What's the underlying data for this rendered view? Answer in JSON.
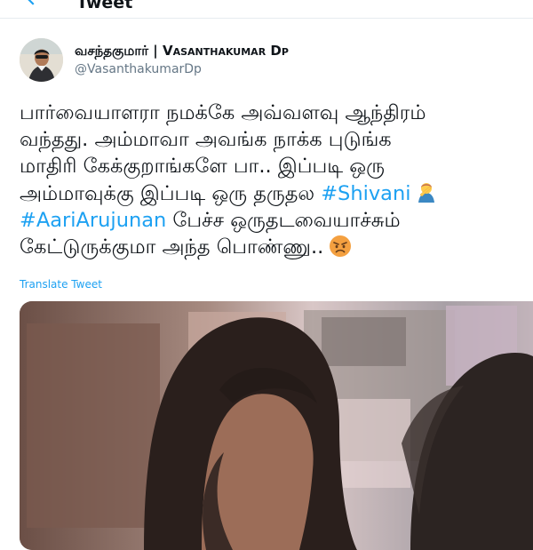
{
  "header": {
    "title": "Tweet"
  },
  "author": {
    "name_tamil": "வசந்தகுமார்",
    "separator": " | ",
    "name_latin": "Vasanthakumar Dp",
    "handle": "@VasanthakumarDp"
  },
  "tweet": {
    "line1": "பார்வையாளரா நமக்கே அவ்வளவு ஆந்திரம்",
    "line2": "வந்தது. அம்மாவா அவங்க நாக்க புடுங்க",
    "line3": "மாதிரி கேக்குறாங்களே பா.. இப்படி ஒரு",
    "line4_text": "அம்மாவுக்கு இப்படி ஒரு தருதல ",
    "hashtag1": "#Shivani",
    "hashtag2": "#AariArujunan",
    "line5_text": " பேச்ச ஒருதடவையாச்சும்",
    "line6": "கேட்டுருக்குமா அந்த பொண்ணு..",
    "translate_label": "Translate Tweet"
  },
  "icons": {
    "back": "back-arrow-icon",
    "emoji1": "man-facepalming-emoji",
    "emoji2": "angry-face-emoji"
  },
  "colors": {
    "accent": "#1da1f2",
    "text": "#0f1419",
    "secondary": "#657786"
  }
}
